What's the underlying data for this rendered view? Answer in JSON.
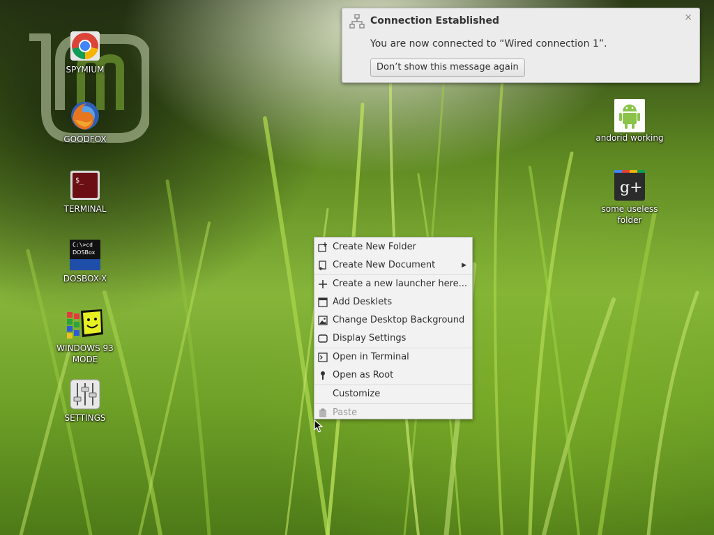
{
  "desktop": {
    "left_icons": [
      {
        "label": "SPYMIUM",
        "icon": "chrome-icon"
      },
      {
        "label": "GOODFOX",
        "icon": "firefox-icon"
      },
      {
        "label": "TERMINAL",
        "icon": "terminal-icon"
      },
      {
        "label": "DOSBOX-X",
        "icon": "dosbox-icon",
        "icon_text": [
          "C:\\>cd",
          "DOSBox"
        ]
      },
      {
        "label": "WINDOWS 93 MODE",
        "icon": "windows93-icon"
      },
      {
        "label": "SETTINGS",
        "icon": "settings-sliders-icon"
      }
    ],
    "right_icons": [
      {
        "label": "andorid working",
        "icon": "android-icon"
      },
      {
        "label": "some useless folder",
        "icon": "google-plus-icon",
        "icon_text": "g+"
      }
    ]
  },
  "notification": {
    "title": "Connection Established",
    "body": "You are now connected to “Wired connection 1”.",
    "button": "Don’t show this message again",
    "close": "×",
    "icon": "network-wired-icon"
  },
  "context_menu": {
    "items": [
      {
        "label": "Create New Folder",
        "icon": "folder-add-icon"
      },
      {
        "label": "Create New Document",
        "icon": "document-new-icon",
        "submenu": true
      },
      {
        "label": "Create a new launcher here...",
        "icon": "plus-icon"
      },
      {
        "label": "Add Desklets",
        "icon": "desklet-icon"
      },
      {
        "label": "Change Desktop Background",
        "icon": "image-icon"
      },
      {
        "label": "Display Settings",
        "icon": "display-icon"
      },
      {
        "label": "Open in Terminal",
        "icon": "terminal-small-icon"
      },
      {
        "label": "Open as Root",
        "icon": "key-icon"
      },
      {
        "label": "Customize",
        "icon": ""
      },
      {
        "label": "Paste",
        "icon": "paste-icon",
        "disabled": true
      }
    ],
    "submenu_arrow": "▶"
  },
  "colors": {
    "menu_bg": "#f2f2f2",
    "notification_bg": "#ececec",
    "mint_green": "#87b83a"
  }
}
